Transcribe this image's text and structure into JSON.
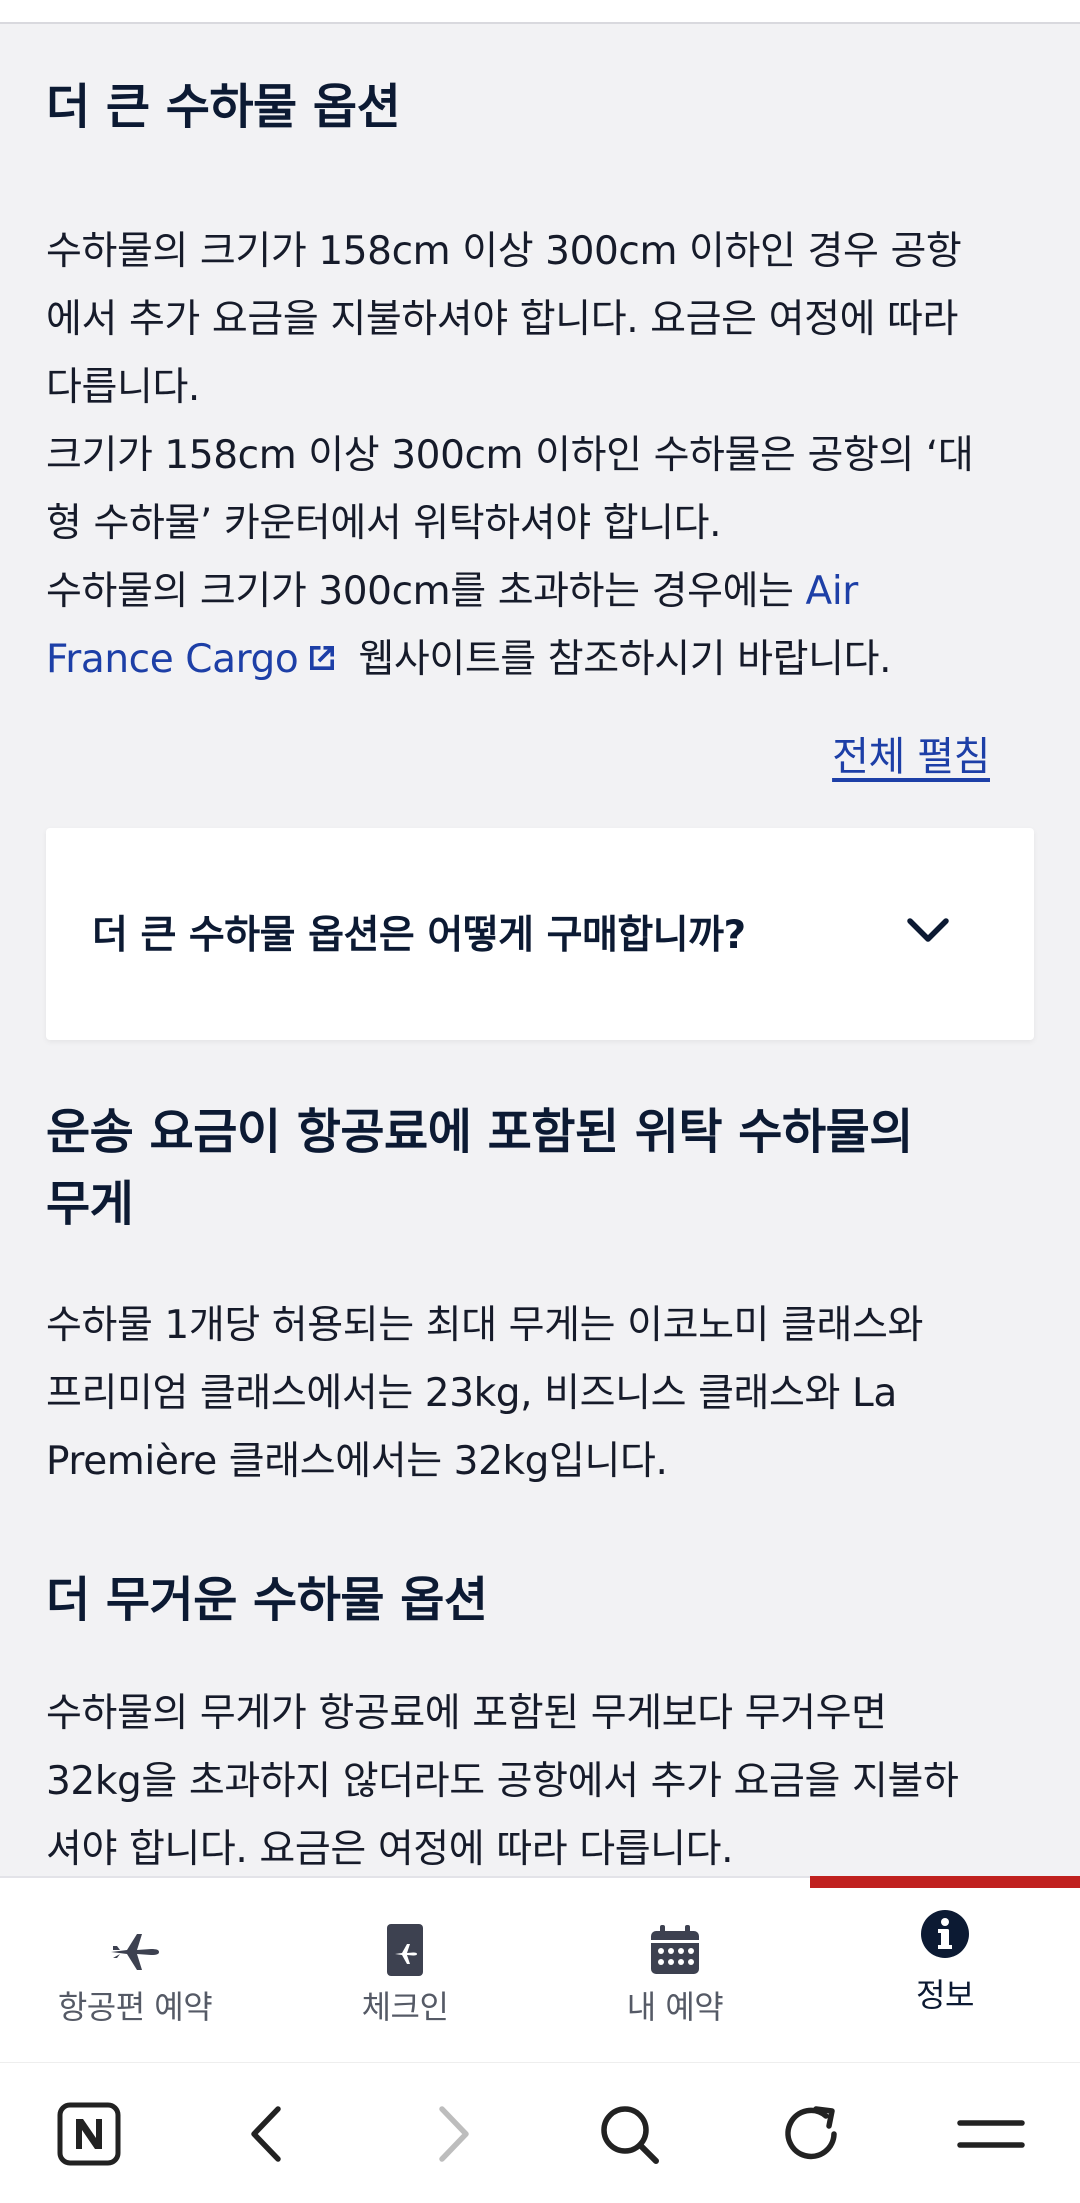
{
  "larger_baggage": {
    "heading": "더 큰 수하물 옵션",
    "line1": "수하물의 크기가 158cm 이상 300cm 이하인 경우 공항",
    "line2": "에서 추가 요금을 지불하셔야 합니다. 요금은 여정에 따라",
    "line3": "다릅니다.",
    "line4": "크기가 158cm 이상 300cm 이하인 수하물은 공항의 ‘대",
    "line5": "형 수하물’ 카운터에서 위탁하셔야 합니다.",
    "line6_prefix": "수하물의 크기가 300cm를 초과하는 경우에는 ",
    "link_part1": "Air",
    "link_part2": "France Cargo",
    "line7_suffix": "웹사이트를 참조하시기 바랍니다."
  },
  "expand_all_label": "전체 펼침",
  "accordion": {
    "question": "더 큰 수하물 옵션은 어떻게 구매합니까?"
  },
  "weight": {
    "heading_line1": "운송 요금이 항공료에 포함된 위탁 수하물의",
    "heading_line2": "무게",
    "line1": "수하물 1개당 허용되는 최대 무게는 이코노미 클래스와",
    "line2": "프리미엄 클래스에서는 23kg, 비즈니스 클래스와 La",
    "line3": "Première 클래스에서는 32kg입니다."
  },
  "heavier_baggage": {
    "heading": "더 무거운 수하물 옵션",
    "line1": "수하물의 무게가 항공료에 포함된 무게보다 무거우면",
    "line2": "32kg을 초과하지 않더라도 공항에서 추가 요금을 지불하",
    "line3": "셔야 합니다. 요금은 여정에 따라 다릅니다."
  },
  "bottom_nav": {
    "items": [
      {
        "label": "항공편 예약",
        "icon": "airplane-icon"
      },
      {
        "label": "체크인",
        "icon": "boarding-pass-icon"
      },
      {
        "label": "내 예약",
        "icon": "calendar-icon"
      },
      {
        "label": "정보",
        "icon": "info-icon",
        "active": true
      }
    ]
  },
  "browser_bar": {
    "buttons": [
      "naver-home-icon",
      "back-icon",
      "forward-icon",
      "search-icon",
      "reload-icon",
      "menu-icon"
    ]
  },
  "colors": {
    "link": "#1d3fa7",
    "active_indicator": "#c0211f",
    "text_dark": "#0c1a33",
    "page_bg": "#f2f2f4"
  }
}
